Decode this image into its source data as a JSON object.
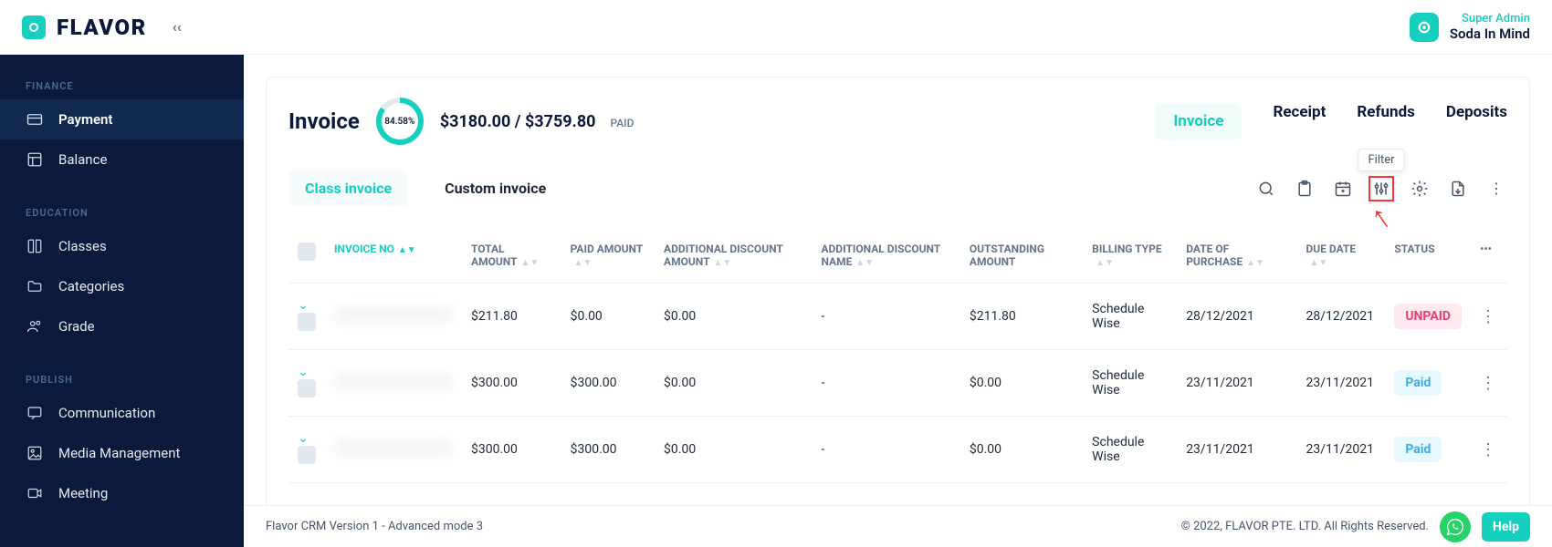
{
  "brand": {
    "name": "FLAVOR"
  },
  "user": {
    "role": "Super Admin",
    "name": "Soda In Mind"
  },
  "sidebar": {
    "sections": {
      "finance": "FINANCE",
      "education": "EDUCATION",
      "publish": "PUBLISH"
    },
    "items": {
      "payment": "Payment",
      "balance": "Balance",
      "classes": "Classes",
      "categories": "Categories",
      "grade": "Grade",
      "communication": "Communication",
      "media": "Media Management",
      "meeting": "Meeting"
    }
  },
  "page": {
    "title": "Invoice",
    "donut_pct": "84.58%",
    "amount_paid": "$3180.00",
    "amount_sep": " / ",
    "amount_total": "$3759.80",
    "paid_label": "PAID"
  },
  "top_tabs": {
    "invoice": "Invoice",
    "receipt": "Receipt",
    "refunds": "Refunds",
    "deposits": "Deposits"
  },
  "invoice_tabs": {
    "class": "Class invoice",
    "custom": "Custom invoice"
  },
  "tooltip_filter": "Filter",
  "table": {
    "headers": {
      "invoice_no": "INVOICE NO",
      "total": "TOTAL AMOUNT",
      "paid": "PAID AMOUNT",
      "add_disc_amt": "ADDITIONAL DISCOUNT AMOUNT",
      "add_disc_name": "ADDITIONAL DISCOUNT NAME",
      "outstanding": "OUTSTANDING AMOUNT",
      "billing": "BILLING TYPE",
      "dop": "DATE OF PURCHASE",
      "due": "DUE DATE",
      "status": "STATUS"
    },
    "rows": [
      {
        "total": "$211.80",
        "paid": "$0.00",
        "add_disc_amt": "$0.00",
        "add_disc_name": "-",
        "outstanding": "$211.80",
        "billing": "Schedule Wise",
        "dop": "28/12/2021",
        "due": "28/12/2021",
        "status": "UNPAID",
        "status_class": "unpaid"
      },
      {
        "total": "$300.00",
        "paid": "$300.00",
        "add_disc_amt": "$0.00",
        "add_disc_name": "-",
        "outstanding": "$0.00",
        "billing": "Schedule Wise",
        "dop": "23/11/2021",
        "due": "23/11/2021",
        "status": "Paid",
        "status_class": "paid"
      },
      {
        "total": "$300.00",
        "paid": "$300.00",
        "add_disc_amt": "$0.00",
        "add_disc_name": "-",
        "outstanding": "$0.00",
        "billing": "Schedule Wise",
        "dop": "23/11/2021",
        "due": "23/11/2021",
        "status": "Paid",
        "status_class": "paid"
      }
    ]
  },
  "footer": {
    "left": "Flavor CRM Version 1 - Advanced mode 3",
    "right": "© 2022, FLAVOR PTE. LTD. All Rights Reserved.",
    "help": "Help"
  }
}
